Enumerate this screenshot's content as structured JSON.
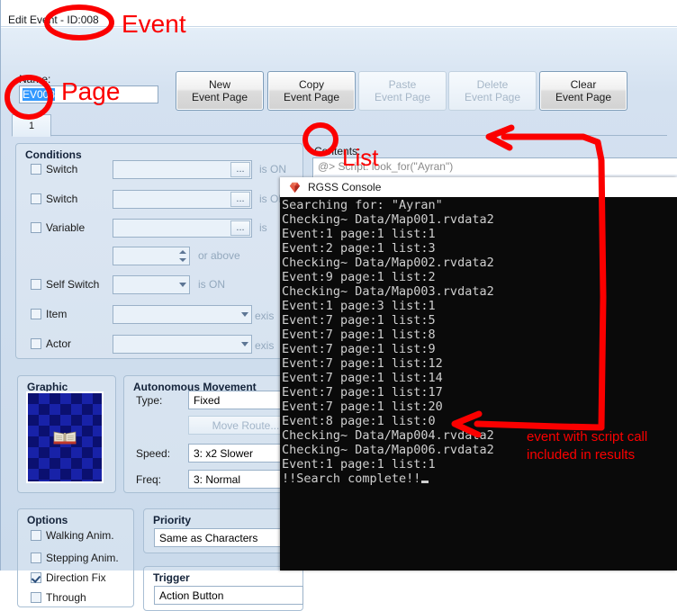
{
  "window": {
    "title": "Edit Event - ID:008"
  },
  "name_field": {
    "label": "Name:",
    "value": "EV008"
  },
  "toolbar": {
    "buttons": [
      {
        "line1": "New",
        "line2": "Event Page",
        "enabled": true
      },
      {
        "line1": "Copy",
        "line2": "Event Page",
        "enabled": true
      },
      {
        "line1": "Paste",
        "line2": "Event Page",
        "enabled": false
      },
      {
        "line1": "Delete",
        "line2": "Event Page",
        "enabled": false
      },
      {
        "line1": "Clear",
        "line2": "Event Page",
        "enabled": true
      }
    ]
  },
  "tabs": [
    {
      "label": "1",
      "selected": true
    }
  ],
  "conditions": {
    "title": "Conditions",
    "rows": [
      {
        "label": "Switch",
        "checked": false,
        "suffix": "is ON"
      },
      {
        "label": "Switch",
        "checked": false,
        "suffix": "is ON"
      },
      {
        "label": "Variable",
        "checked": false,
        "suffix": "is"
      },
      {
        "label": "",
        "checked": false,
        "suffix": "or above"
      },
      {
        "label": "Self Switch",
        "checked": false,
        "suffix": "is ON"
      },
      {
        "label": "Item",
        "checked": false,
        "suffix": "exis"
      },
      {
        "label": "Actor",
        "checked": false,
        "suffix": "exis"
      }
    ],
    "ellipsis": "..."
  },
  "graphic": {
    "title": "Graphic"
  },
  "movement": {
    "title": "Autonomous Movement",
    "type_label": "Type:",
    "type_value": "Fixed",
    "move_route_label": "Move Route...",
    "speed_label": "Speed:",
    "speed_value": "3: x2 Slower",
    "freq_label": "Freq:",
    "freq_value": "3: Normal"
  },
  "options": {
    "title": "Options",
    "items": [
      {
        "label": "Walking Anim.",
        "checked": false
      },
      {
        "label": "Stepping Anim.",
        "checked": false
      },
      {
        "label": "Direction Fix",
        "checked": true
      },
      {
        "label": "Through",
        "checked": false
      }
    ]
  },
  "priority": {
    "title": "Priority",
    "value": "Same as Characters"
  },
  "trigger": {
    "title": "Trigger",
    "value": "Action Button"
  },
  "contents": {
    "label": "Contents:",
    "lines": [
      "@> Script: look_for(\"Ayran\")",
      "@>"
    ]
  },
  "console": {
    "title": "RGSS Console",
    "icon": "ruby-gem-icon",
    "lines": [
      "Searching for: \"Ayran\"",
      "Checking~ Data/Map001.rvdata2",
      "Event:1 page:1 list:1",
      "Event:2 page:1 list:3",
      "Checking~ Data/Map002.rvdata2",
      "Event:9 page:1 list:2",
      "Checking~ Data/Map003.rvdata2",
      "Event:1 page:3 list:1",
      "Event:7 page:1 list:5",
      "Event:7 page:1 list:8",
      "Event:7 page:1 list:9",
      "Event:7 page:1 list:12",
      "Event:7 page:1 list:14",
      "Event:7 page:1 list:17",
      "Event:7 page:1 list:20",
      "Event:8 page:1 list:0",
      "Checking~ Data/Map004.rvdata2",
      "Checking~ Data/Map006.rvdata2",
      "Event:1 page:1 list:1",
      "!!Search complete!!"
    ]
  },
  "annotations": {
    "event": "Event",
    "page": "Page",
    "list": "List",
    "note_line1": "event with script call",
    "note_line2": "included in results",
    "color": "#fb0000"
  }
}
